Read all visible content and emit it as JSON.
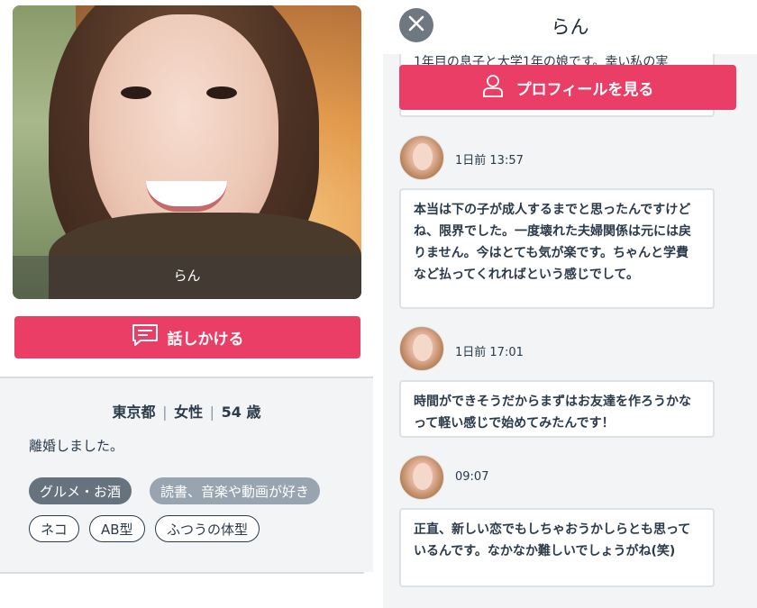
{
  "left": {
    "photo_caption": "らん",
    "talk_button_label": "話しかける",
    "info": {
      "location": "東京都",
      "gender": "女性",
      "age": "54 歳",
      "separator": "|"
    },
    "bio": "離婚しました。",
    "tags_filled": [
      "グルメ・お酒",
      "読書、音楽や動画が好き"
    ],
    "tags_outline": [
      "ネコ",
      "AB型",
      "ふつうの体型"
    ]
  },
  "right": {
    "header_title": "らん",
    "partial_message": "1年目の息子と大学1年の娘です。幸い私の実",
    "profile_button_label": "プロフィールを見る",
    "messages": [
      {
        "time": "1日前 13:57",
        "text": "本当は下の子が成人するまでと思ったんですけどね、限界でした。一度壊れた夫婦関係は元には戻りません。今はとても気が楽です。ちゃんと学費など払ってくれればという感じでして。"
      },
      {
        "time": "1日前 17:01",
        "text": "時間ができそうだからまずはお友達を作ろうかなって軽い感じで始めてみたんです！"
      },
      {
        "time": "09:07",
        "text": "正直、新しい恋でもしちゃおうかしらとも思っているんです。なかなか難しいでしょうがね(笑)"
      }
    ]
  },
  "icons": {
    "chat": "chat-bubble-icon",
    "user": "user-icon",
    "close": "close-icon"
  },
  "colors": {
    "accent": "#ea3e66",
    "panel_bg": "#f2f4f6",
    "text": "#2b3a4a"
  }
}
